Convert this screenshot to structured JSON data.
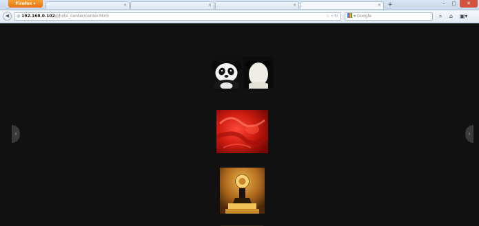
{
  "browser": {
    "menu_button": "Firefox",
    "tabs": [
      {
        "label": "",
        "active": false
      },
      {
        "label": "",
        "active": false
      },
      {
        "label": "",
        "active": false
      },
      {
        "label": "",
        "active": true
      }
    ],
    "new_tab": "+",
    "window_controls": {
      "minimize": "–",
      "maximize": "□",
      "close": "✕"
    }
  },
  "navbar": {
    "url_host": "192.168.0.102",
    "url_path": "/photo_center/center.html",
    "search_placeholder": "Google"
  },
  "gallery": {
    "prev_arrow": "‹",
    "next_arrow": "›",
    "items": [
      {
        "subject": "panda-front"
      },
      {
        "subject": "panda-back"
      },
      {
        "subject": "red-abstract"
      },
      {
        "subject": "golden-statue"
      }
    ]
  },
  "colors": {
    "page_background": "#111111",
    "tab_strip": "#c7d7ea",
    "firefox_orange": "#e8720d",
    "close_red": "#d2513f"
  }
}
